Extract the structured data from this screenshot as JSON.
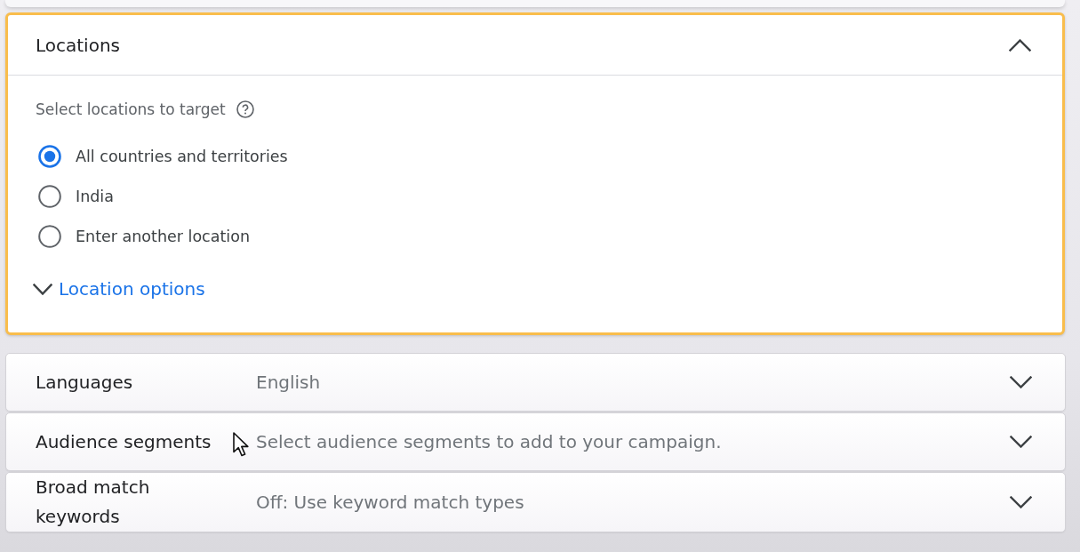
{
  "locations": {
    "title": "Locations",
    "expanded": true,
    "highlighted": true,
    "prompt": "Select locations to target",
    "options": [
      {
        "label": "All countries and territories",
        "selected": true
      },
      {
        "label": "India",
        "selected": false
      },
      {
        "label": "Enter another location",
        "selected": false
      }
    ],
    "more_link": {
      "label": "Location options",
      "expanded": false
    }
  },
  "settings_rows": [
    {
      "label": "Languages",
      "value": "English",
      "expanded": false
    },
    {
      "label": "Audience segments",
      "value": "Select audience segments to add to your campaign.",
      "expanded": false
    },
    {
      "label": "Broad match keywords",
      "value": "Off: Use keyword match types",
      "expanded": false
    }
  ]
}
